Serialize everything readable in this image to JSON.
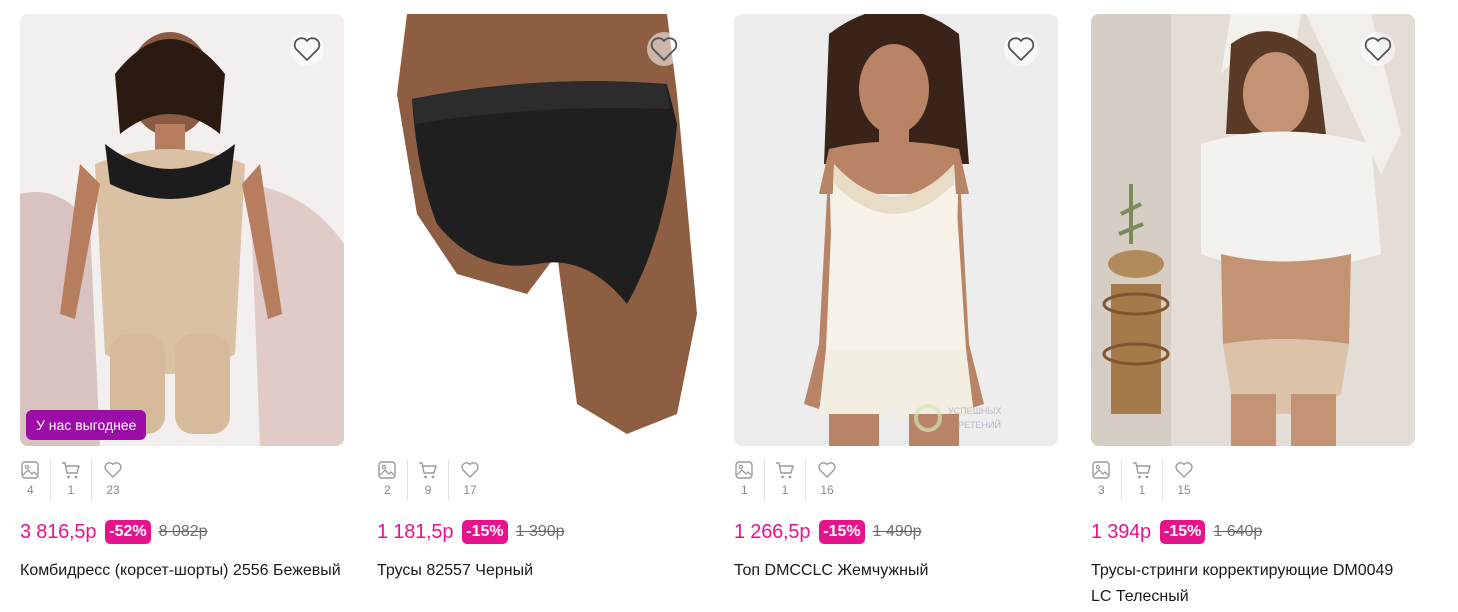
{
  "colors": {
    "accent": "#e5138c",
    "offer_badge": "#9b0ca8",
    "muted": "#8a8a8a"
  },
  "products": [
    {
      "badge": "У нас выгоднее",
      "stats": {
        "photos": "4",
        "in_cart": "1",
        "likes": "23"
      },
      "price": "3 816,5р",
      "discount": "-52%",
      "old_price": "8 082р",
      "title": "Комбидресс (корсет-шорты) 2556 Бежевый"
    },
    {
      "badge": "",
      "stats": {
        "photos": "2",
        "in_cart": "9",
        "likes": "17"
      },
      "price": "1 181,5р",
      "discount": "-15%",
      "old_price": "1 390р",
      "title": "Трусы 82557 Черный"
    },
    {
      "badge": "",
      "stats": {
        "photos": "1",
        "in_cart": "1",
        "likes": "16"
      },
      "price": "1 266,5р",
      "discount": "-15%",
      "old_price": "1 490р",
      "title": "Топ DMCCLC Жемчужный"
    },
    {
      "badge": "",
      "stats": {
        "photos": "3",
        "in_cart": "1",
        "likes": "15"
      },
      "price": "1 394р",
      "discount": "-15%",
      "old_price": "1 640р",
      "title": "Трусы-стринги корректирующие DM0049 LC Телесный"
    }
  ]
}
